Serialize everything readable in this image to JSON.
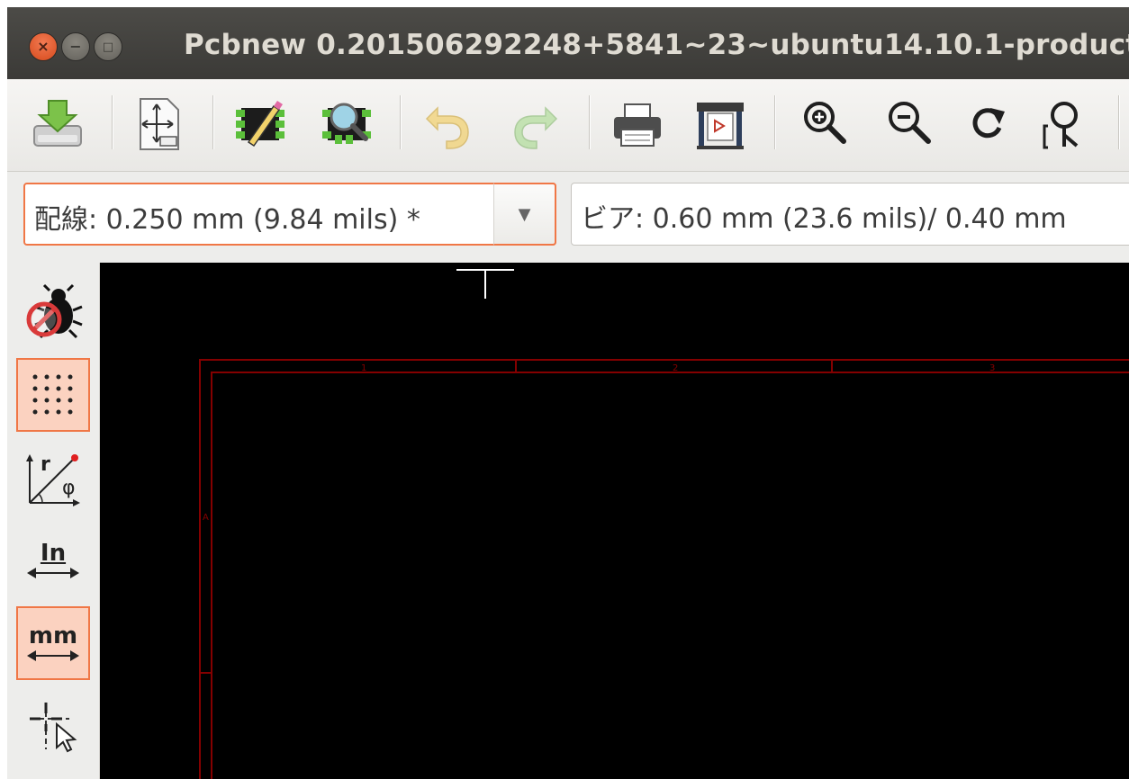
{
  "window": {
    "title": "Pcbnew 0.201506292248+5841~23~ubuntu14.10.1-product",
    "close_glyph": "×",
    "minimize_glyph": "−",
    "maximize_glyph": "□"
  },
  "toolbar": {
    "buttons": [
      {
        "name": "save-board",
        "icon": "save-icon"
      },
      {
        "name": "page-settings",
        "icon": "page-settings-icon"
      },
      {
        "name": "footprint-editor",
        "icon": "footprint-editor-icon"
      },
      {
        "name": "footprint-viewer",
        "icon": "footprint-viewer-icon"
      },
      {
        "name": "undo",
        "icon": "undo-icon"
      },
      {
        "name": "redo",
        "icon": "redo-icon"
      },
      {
        "name": "print",
        "icon": "print-icon"
      },
      {
        "name": "plot",
        "icon": "plot-icon"
      },
      {
        "name": "zoom-in",
        "icon": "zoom-in-icon"
      },
      {
        "name": "zoom-out",
        "icon": "zoom-out-icon"
      },
      {
        "name": "redraw",
        "icon": "redraw-icon"
      },
      {
        "name": "zoom-fit",
        "icon": "zoom-fit-icon"
      }
    ]
  },
  "selectors": {
    "track_width": "配線: 0.250 mm (9.84 mils) *",
    "via_size": "ビア: 0.60 mm (23.6 mils)/ 0.40 mm"
  },
  "left_toolbar": {
    "units_inch_label": "In",
    "units_mm_label": "mm",
    "polar_r_label": "r",
    "polar_phi_label": "φ",
    "active_tools": [
      "grid",
      "units-mm"
    ]
  },
  "canvas": {
    "background": "#000000",
    "frame_color": "#840000",
    "top_ruler_labels": [
      "1",
      "2",
      "3"
    ],
    "left_ruler_labels": [
      "A"
    ]
  },
  "colors": {
    "accent": "#f07746",
    "titlebar": "#3c3b37"
  }
}
